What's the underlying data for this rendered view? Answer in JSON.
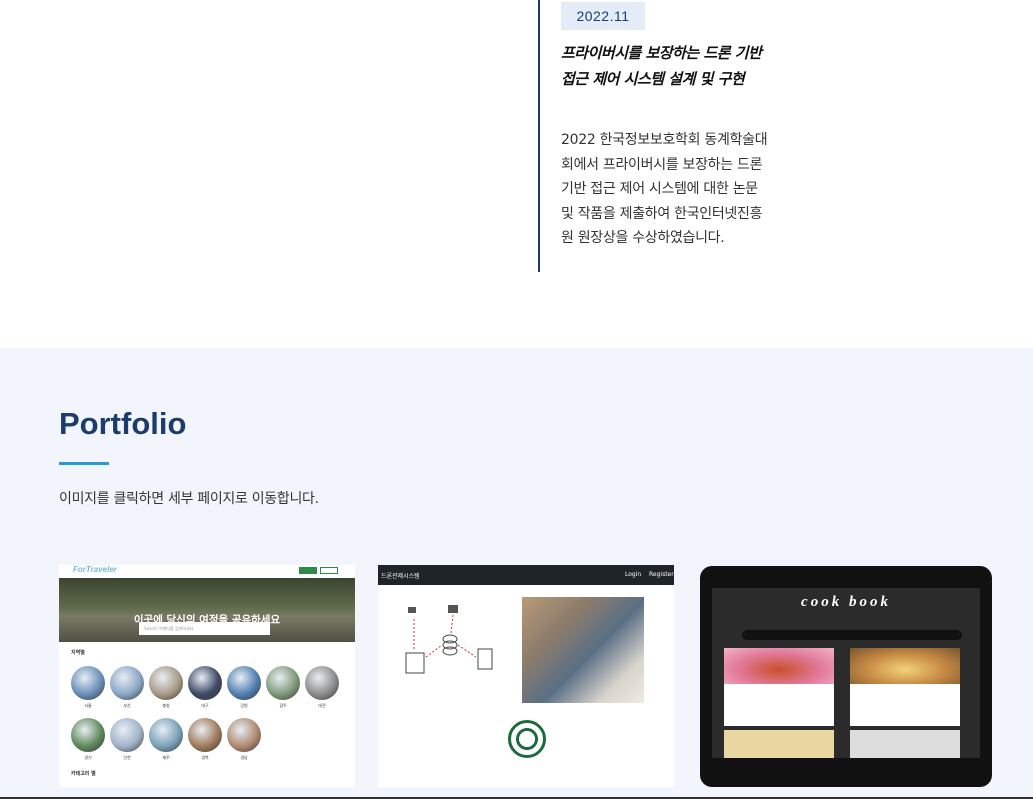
{
  "timeline": {
    "date": "2022.11",
    "title": "프라이버시를 보장하는 드론 기반 접근 제어 시스템 설계 및 구현",
    "description": "2022 한국정보보호학회 동계학술대회에서 프라이버시를 보장하는 드론 기반 접근 제어 시스템에 대한 논문 및 작품을 제출하여 한국인터넷진흥원 원장상을 수상하였습니다."
  },
  "portfolio": {
    "title": "Portfolio",
    "description": "이미지를 클릭하면 세부 페이지로 이동합니다."
  },
  "cards": {
    "travel": {
      "logo": "ForTraveler",
      "hero_text": "이곳에 당신의 여정을 공유하세요",
      "search_placeholder": "Search 여행지를 검색하세요",
      "section1": "지역별",
      "section2": "카테고리 별",
      "regions": [
        "서울",
        "부산",
        "충청",
        "대구",
        "강원",
        "광주",
        "대전",
        "경기",
        "인천",
        "제주",
        "경북",
        "경남"
      ],
      "colors": {
        "hero": "#5e6b4a",
        "button": "#2e8b47"
      }
    },
    "drone": {
      "bar_title": "드론관제시스템",
      "login": "Login",
      "register": "Register"
    },
    "cookbook": {
      "title": "cook book"
    }
  }
}
